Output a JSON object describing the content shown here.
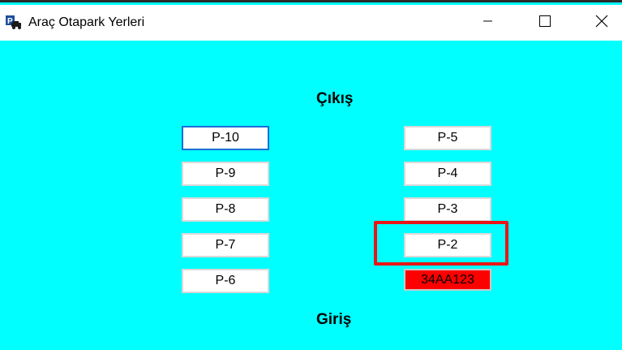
{
  "window": {
    "title": "Araç Otapark Yerleri",
    "icon": "car-parking-app-icon",
    "controls": {
      "minimize_icon": "minimize-icon",
      "maximize_icon": "maximize-icon",
      "close_icon": "close-icon"
    }
  },
  "colors": {
    "background": "#00ffff",
    "occupied": "#ff0000",
    "highlight": "#e81616",
    "focus_border": "#1a6fd8"
  },
  "labels": {
    "exit": "Çıkış",
    "entrance": "Giriş"
  },
  "left_column": [
    {
      "label": "P-10",
      "state": "focused"
    },
    {
      "label": "P-9",
      "state": "empty"
    },
    {
      "label": "P-8",
      "state": "empty"
    },
    {
      "label": "P-7",
      "state": "empty"
    },
    {
      "label": "P-6",
      "state": "empty"
    }
  ],
  "right_column": [
    {
      "label": "P-5",
      "state": "empty"
    },
    {
      "label": "P-4",
      "state": "empty"
    },
    {
      "label": "P-3",
      "state": "empty"
    },
    {
      "label": "P-2",
      "state": "highlighted"
    },
    {
      "label": "34AA123",
      "state": "occupied"
    }
  ]
}
